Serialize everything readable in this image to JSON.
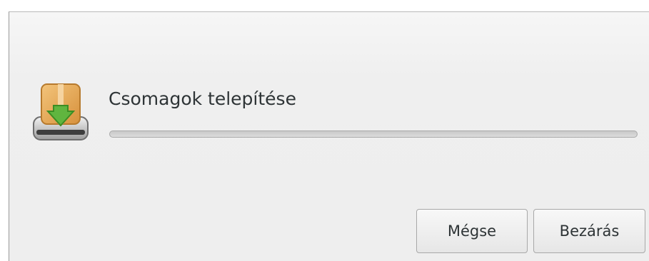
{
  "dialog": {
    "heading": "Csomagok telepítése",
    "progress_fraction": 0,
    "icon": "package-install-icon"
  },
  "buttons": {
    "cancel_label": "Mégse",
    "close_label": "Bezárás"
  },
  "colors": {
    "background": "#efefef",
    "text": "#2e3436",
    "progress_track": "#d2d2d2",
    "icon_green": "#59b53a",
    "icon_box": "#e9b06b"
  }
}
